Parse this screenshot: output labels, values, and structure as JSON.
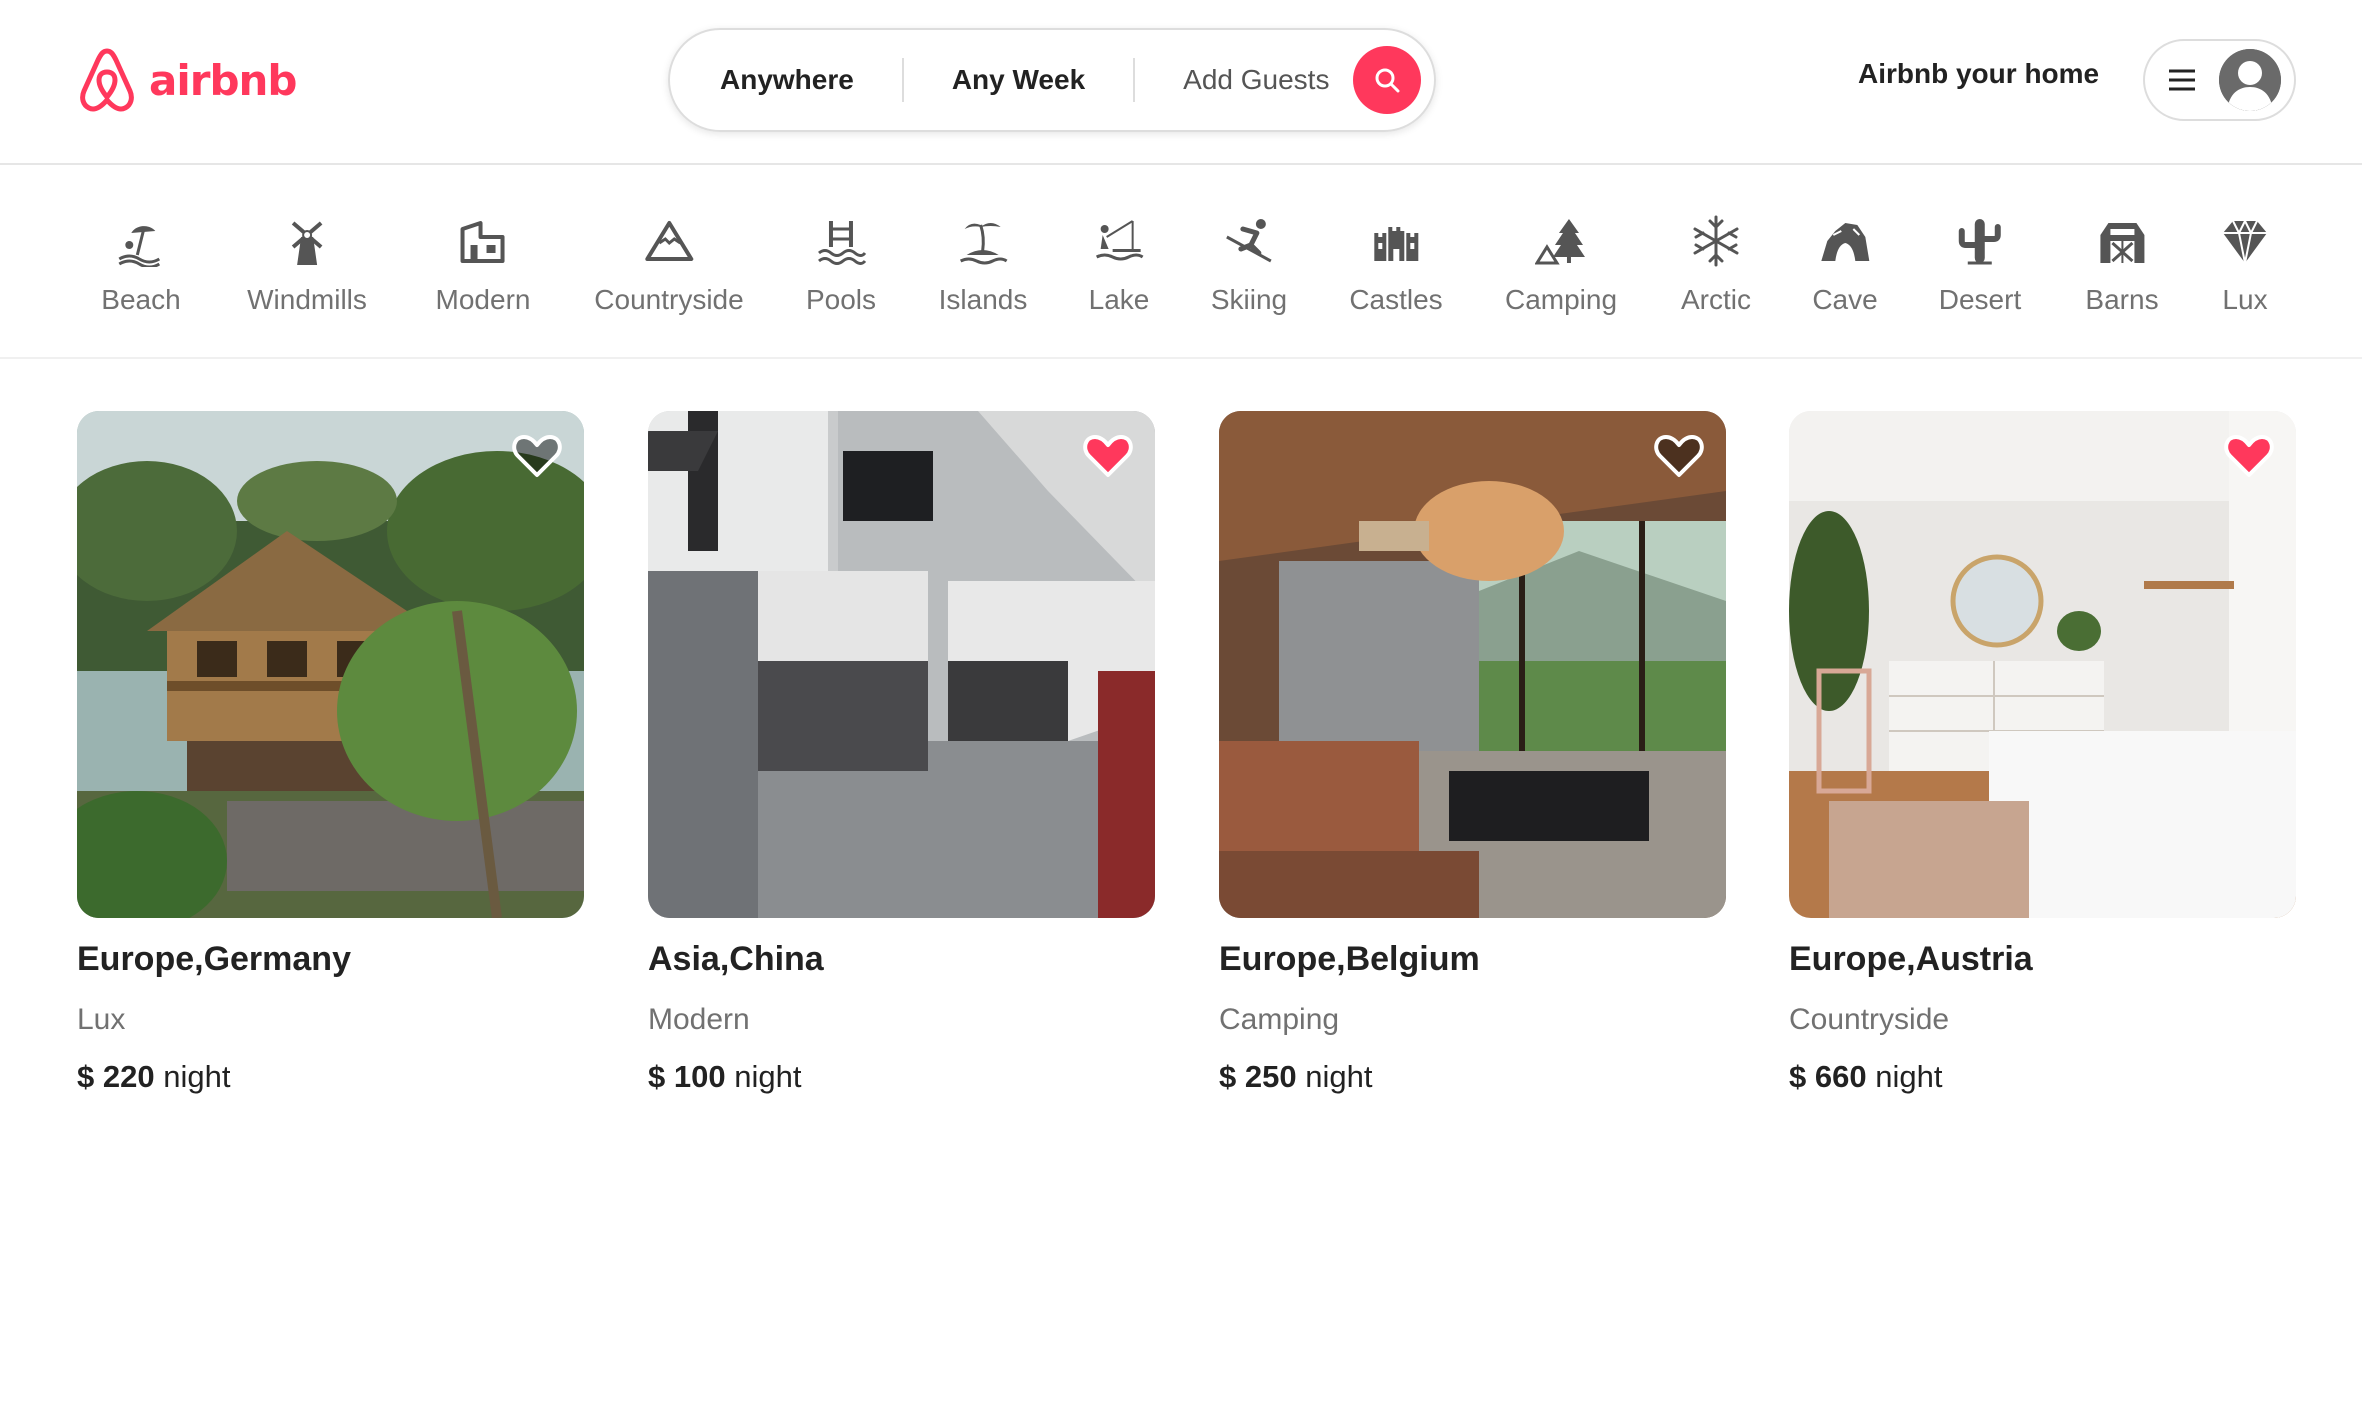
{
  "brand": {
    "name": "airbnb",
    "color": "#ff385c"
  },
  "search": {
    "where": "Anywhere",
    "when": "Any Week",
    "who": "Add Guests",
    "button_icon": "search-icon"
  },
  "header": {
    "host_link": "Airbnb your home",
    "menu_icon": "hamburger-menu-icon",
    "avatar_icon": "user-avatar-icon"
  },
  "categories": [
    {
      "label": "Beach",
      "icon": "beach-icon"
    },
    {
      "label": "Windmills",
      "icon": "windmill-icon"
    },
    {
      "label": "Modern",
      "icon": "modern-house-icon"
    },
    {
      "label": "Countryside",
      "icon": "mountain-icon"
    },
    {
      "label": "Pools",
      "icon": "pool-icon"
    },
    {
      "label": "Islands",
      "icon": "island-icon"
    },
    {
      "label": "Lake",
      "icon": "lake-icon"
    },
    {
      "label": "Skiing",
      "icon": "skiing-icon"
    },
    {
      "label": "Castles",
      "icon": "castle-icon"
    },
    {
      "label": "Camping",
      "icon": "camping-icon"
    },
    {
      "label": "Arctic",
      "icon": "snowflake-icon"
    },
    {
      "label": "Cave",
      "icon": "cave-icon"
    },
    {
      "label": "Desert",
      "icon": "cactus-icon"
    },
    {
      "label": "Barns",
      "icon": "barn-icon"
    },
    {
      "label": "Lux",
      "icon": "diamond-icon"
    }
  ],
  "listings": [
    {
      "location": "Europe,Germany",
      "category": "Lux",
      "currency": "$",
      "price": "220",
      "unit": "night",
      "favorited": false
    },
    {
      "location": "Asia,China",
      "category": "Modern",
      "currency": "$",
      "price": "100",
      "unit": "night",
      "favorited": true
    },
    {
      "location": "Europe,Belgium",
      "category": "Camping",
      "currency": "$",
      "price": "250",
      "unit": "night",
      "favorited": false
    },
    {
      "location": "Europe,Austria",
      "category": "Countryside",
      "currency": "$",
      "price": "660",
      "unit": "night",
      "favorited": true
    }
  ]
}
